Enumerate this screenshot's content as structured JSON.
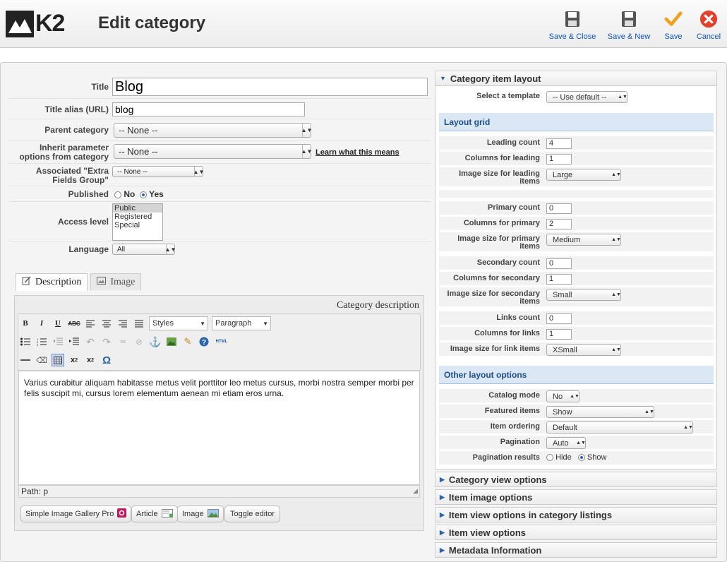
{
  "app": {
    "logo_text": "K2",
    "page_title": "Edit category"
  },
  "toolbar": [
    {
      "label": "Save & Close",
      "icon": "save-icon"
    },
    {
      "label": "Save & New",
      "icon": "save-icon"
    },
    {
      "label": "Save",
      "icon": "checkmark-icon"
    },
    {
      "label": "Cancel",
      "icon": "cancel-icon"
    }
  ],
  "form": {
    "title_label": "Title",
    "title_value": "Blog",
    "alias_label": "Title alias (URL)",
    "alias_value": "blog",
    "parent_label": "Parent category",
    "parent_value": "-- None --",
    "inherit_label_1": "Inherit parameter",
    "inherit_label_2": "options from category",
    "inherit_value": "-- None --",
    "learn_link": "Learn what this means",
    "extra_label_1": "Associated \"Extra",
    "extra_label_2": "Fields Group\"",
    "extra_value": "-- None --",
    "published_label": "Published",
    "published_no": "No",
    "published_yes": "Yes",
    "published_selected": "Yes",
    "access_label": "Access level",
    "access_options": [
      "Public",
      "Registered",
      "Special"
    ],
    "access_selected": "Public",
    "language_label": "Language",
    "language_value": "All"
  },
  "tabs": [
    {
      "label": "Description",
      "icon": "edit-icon"
    },
    {
      "label": "Image",
      "icon": "image-icon"
    }
  ],
  "editor": {
    "header": "Category description",
    "styles_select": "Styles",
    "format_select": "Paragraph",
    "content": "Varius curabitur aliquam habitasse metus velit porttitor leo metus cursus, morbi nostra semper morbi per felis suscipit mi, cursus lorem elementum aenean mi etiam eros urna.",
    "path": "Path: p",
    "buttons": [
      "Simple Image Gallery Pro",
      "Article",
      "Image",
      "Toggle editor"
    ]
  },
  "right": {
    "layout_header": "Category item layout",
    "template_label": "Select a template",
    "template_value": "-- Use default --",
    "grid_header": "Layout grid",
    "grid": [
      {
        "label": "Leading count",
        "value": "4",
        "type": "input"
      },
      {
        "label": "Columns for leading",
        "value": "1",
        "type": "input"
      },
      {
        "label": "Image size for leading items",
        "value": "Large",
        "type": "select"
      },
      {
        "label": "Primary count",
        "value": "0",
        "type": "input"
      },
      {
        "label": "Columns for primary",
        "value": "2",
        "type": "input"
      },
      {
        "label": "Image size for primary items",
        "value": "Medium",
        "type": "select"
      },
      {
        "label": "Secondary count",
        "value": "0",
        "type": "input"
      },
      {
        "label": "Columns for secondary",
        "value": "1",
        "type": "input"
      },
      {
        "label": "Image size for secondary items",
        "value": "Small",
        "type": "select"
      },
      {
        "label": "Links count",
        "value": "0",
        "type": "input"
      },
      {
        "label": "Columns for links",
        "value": "1",
        "type": "input"
      },
      {
        "label": "Image size for link items",
        "value": "XSmall",
        "type": "select"
      }
    ],
    "other_header": "Other layout options",
    "other": [
      {
        "label": "Catalog mode",
        "value": "No"
      },
      {
        "label": "Featured items",
        "value": "Show"
      },
      {
        "label": "Item ordering",
        "value": "Default"
      },
      {
        "label": "Pagination",
        "value": "Auto"
      }
    ],
    "pagination_results_label": "Pagination results",
    "pagination_hide": "Hide",
    "pagination_show": "Show",
    "pagination_selected": "Show",
    "collapsed": [
      "Category view options",
      "Item image options",
      "Item view options in category listings",
      "Item view options",
      "Metadata Information"
    ]
  }
}
